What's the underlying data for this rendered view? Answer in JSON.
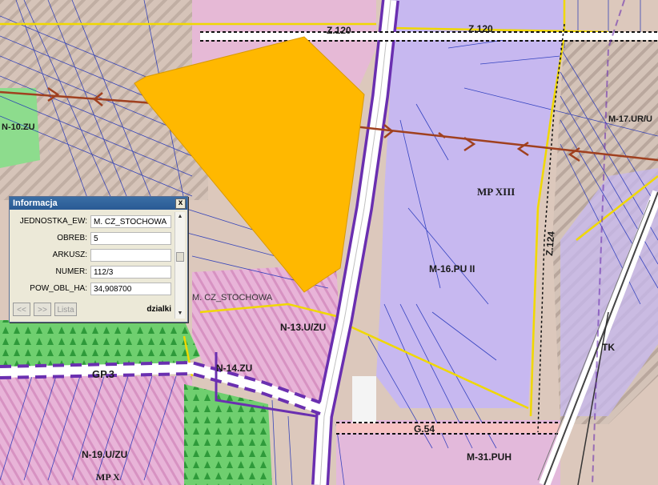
{
  "map": {
    "road_labels": [
      "Z.120",
      "Z.120",
      "Z.124",
      "G.54",
      "GP.3",
      "N-14.ZU"
    ],
    "zone_labels": [
      "N-10.ZU",
      "M-17.UR/U",
      "MP XIII",
      "M-16.PU II",
      "N-13.U/ZU",
      "TK",
      "M-31.PUH",
      "N-19.U/ZU",
      "MP X",
      "M. CZ_STOCHOWA"
    ],
    "parcel_highlight_color": "#ffb800"
  },
  "info": {
    "title": "Informacja",
    "close_symbol": "x",
    "fields": [
      {
        "label": "JEDNOSTKA_EW:",
        "value": "M. CZ_STOCHOWA"
      },
      {
        "label": "OBREB:",
        "value": "5"
      },
      {
        "label": "ARKUSZ:",
        "value": ""
      },
      {
        "label": "NUMER:",
        "value": "112/3"
      },
      {
        "label": "POW_OBL_HA:",
        "value": "34,908700"
      }
    ],
    "prev_label": "<<",
    "next_label": ">>",
    "list_label": "Lista",
    "layer_label": "dzialki"
  }
}
